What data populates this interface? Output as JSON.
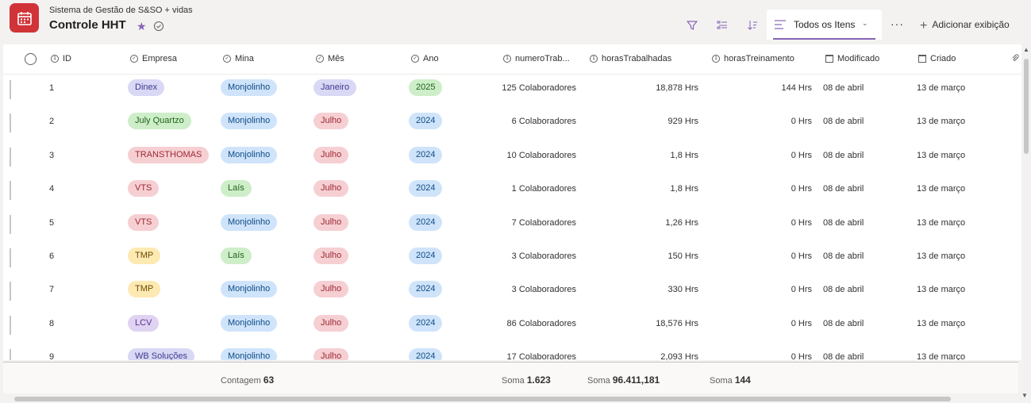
{
  "header": {
    "subtitle": "Sistema de Gestão de S&SO + vidas",
    "title": "Controle HHT",
    "star_icon": "star-icon",
    "view_name": "Todos os Itens",
    "add_view": "Adicionar exibição",
    "more_label": "···"
  },
  "columns": {
    "id": "ID",
    "empresa": "Empresa",
    "mina": "Mina",
    "mes": "Mês",
    "ano": "Ano",
    "numero": "numeroTrab...",
    "horas": "horasTrabalhadas",
    "treino": "horasTreinamento",
    "modificado": "Modificado",
    "criado": "Criado"
  },
  "colors": {
    "accent": "#8764b8",
    "app_icon": "#d13438",
    "pill_blue_bg": "#cfe4fa",
    "pill_blue_fg": "#0f4a85",
    "pill_purple_bg": "#d9d8f5",
    "pill_purple_fg": "#3d3b8e",
    "pill_green_bg": "#cdeec8",
    "pill_green_fg": "#22621e",
    "pill_red_bg": "#f6cfd3",
    "pill_red_fg": "#9e2932",
    "pill_yellow_bg": "#fdeab2",
    "pill_yellow_fg": "#6b4b00",
    "pill_lavender_bg": "#e0d3f2",
    "pill_lavender_fg": "#5c2e91"
  },
  "rows": [
    {
      "id": "1",
      "empresa": "Dinex",
      "empresa_color": "purple",
      "mina": "Monjolinho",
      "mina_color": "blue",
      "mes": "Janeiro",
      "mes_color": "purple",
      "ano": "2025",
      "ano_color": "green",
      "numero": "125 Colaboradores",
      "horas": "18,878 Hrs",
      "treino": "144 Hrs",
      "modificado": "08 de abril",
      "criado": "13 de março"
    },
    {
      "id": "2",
      "empresa": "July Quartzo",
      "empresa_color": "green",
      "mina": "Monjolinho",
      "mina_color": "blue",
      "mes": "Julho",
      "mes_color": "red",
      "ano": "2024",
      "ano_color": "blue",
      "numero": "6 Colaboradores",
      "horas": "929 Hrs",
      "treino": "0 Hrs",
      "modificado": "08 de abril",
      "criado": "13 de março"
    },
    {
      "id": "3",
      "empresa": "TRANSTHOMAS",
      "empresa_color": "red",
      "mina": "Monjolinho",
      "mina_color": "blue",
      "mes": "Julho",
      "mes_color": "red",
      "ano": "2024",
      "ano_color": "blue",
      "numero": "10 Colaboradores",
      "horas": "1,8 Hrs",
      "treino": "0 Hrs",
      "modificado": "08 de abril",
      "criado": "13 de março"
    },
    {
      "id": "4",
      "empresa": "VTS",
      "empresa_color": "red",
      "mina": "Laís",
      "mina_color": "green",
      "mes": "Julho",
      "mes_color": "red",
      "ano": "2024",
      "ano_color": "blue",
      "numero": "1 Colaboradores",
      "horas": "1,8 Hrs",
      "treino": "0 Hrs",
      "modificado": "08 de abril",
      "criado": "13 de março"
    },
    {
      "id": "5",
      "empresa": "VTS",
      "empresa_color": "red",
      "mina": "Monjolinho",
      "mina_color": "blue",
      "mes": "Julho",
      "mes_color": "red",
      "ano": "2024",
      "ano_color": "blue",
      "numero": "7 Colaboradores",
      "horas": "1,26 Hrs",
      "treino": "0 Hrs",
      "modificado": "08 de abril",
      "criado": "13 de março"
    },
    {
      "id": "6",
      "empresa": "TMP",
      "empresa_color": "yellow",
      "mina": "Laís",
      "mina_color": "green",
      "mes": "Julho",
      "mes_color": "red",
      "ano": "2024",
      "ano_color": "blue",
      "numero": "3 Colaboradores",
      "horas": "150 Hrs",
      "treino": "0 Hrs",
      "modificado": "08 de abril",
      "criado": "13 de março"
    },
    {
      "id": "7",
      "empresa": "TMP",
      "empresa_color": "yellow",
      "mina": "Monjolinho",
      "mina_color": "blue",
      "mes": "Julho",
      "mes_color": "red",
      "ano": "2024",
      "ano_color": "blue",
      "numero": "3 Colaboradores",
      "horas": "330 Hrs",
      "treino": "0 Hrs",
      "modificado": "08 de abril",
      "criado": "13 de março"
    },
    {
      "id": "8",
      "empresa": "LCV",
      "empresa_color": "lavender",
      "mina": "Monjolinho",
      "mina_color": "blue",
      "mes": "Julho",
      "mes_color": "red",
      "ano": "2024",
      "ano_color": "blue",
      "numero": "86 Colaboradores",
      "horas": "18,576 Hrs",
      "treino": "0 Hrs",
      "modificado": "08 de abril",
      "criado": "13 de março"
    },
    {
      "id": "9",
      "empresa": "WB Soluções",
      "empresa_color": "purple",
      "mina": "Monjolinho",
      "mina_color": "blue",
      "mes": "Julho",
      "mes_color": "red",
      "ano": "2024",
      "ano_color": "blue",
      "numero": "17 Colaboradores",
      "horas": "2,093 Hrs",
      "treino": "0 Hrs",
      "modificado": "08 de abril",
      "criado": "13 de março"
    }
  ],
  "footer": {
    "count_label": "Contagem",
    "count_value": "63",
    "sum1_label": "Soma",
    "sum1_value": "1.623",
    "sum2_label": "Soma",
    "sum2_value": "96.411,181",
    "sum3_label": "Soma",
    "sum3_value": "144"
  }
}
